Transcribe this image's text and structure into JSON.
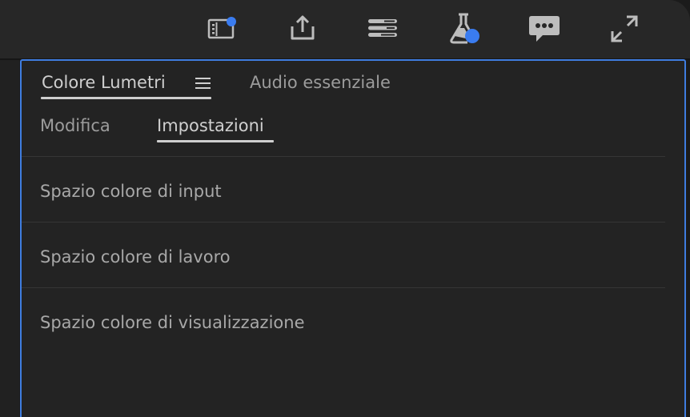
{
  "toolbar": {
    "icons": [
      "panel-notification-icon",
      "export-icon",
      "sliders-icon",
      "flask-icon",
      "comment-icon",
      "fullscreen-icon"
    ],
    "accent": "#3a7cf0"
  },
  "panel": {
    "tabs": [
      {
        "label": "Colore Lumetri",
        "active": true
      },
      {
        "label": "Audio essenziale",
        "active": false
      }
    ],
    "subtabs": [
      {
        "label": "Modifica",
        "active": false
      },
      {
        "label": "Impostazioni",
        "active": true
      }
    ],
    "rows": [
      {
        "label": "Spazio colore di input"
      },
      {
        "label": "Spazio colore di lavoro"
      },
      {
        "label": "Spazio colore di visualizzazione"
      }
    ],
    "border_color": "#3f7de0"
  }
}
